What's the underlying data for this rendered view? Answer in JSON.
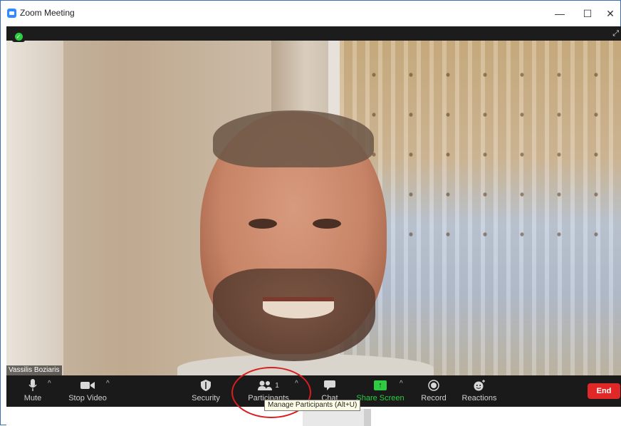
{
  "window": {
    "title": "Zoom Meeting",
    "controls": {
      "minimize": "—",
      "maximize": "☐",
      "close": "✕"
    }
  },
  "video": {
    "participant_name": "Vassilis Boziaris",
    "security_badge": "✓",
    "expand_icon": "⤢"
  },
  "toolbar": {
    "mute_label": "Mute",
    "stop_video_label": "Stop Video",
    "security_label": "Security",
    "participants_label": "Participants",
    "participants_count": "1",
    "chat_label": "Chat",
    "share_screen_label": "Share Screen",
    "record_label": "Record",
    "reactions_label": "Reactions",
    "end_label": "End",
    "caret": "^"
  },
  "tooltip": {
    "text": "Manage Participants (Alt+U)"
  },
  "colors": {
    "accent": "#2d8cff",
    "toolbar_bg": "#1a1a1a",
    "share_green": "#2ecc40",
    "end_red": "#e02828",
    "highlight_red": "#d81e1e"
  },
  "icons": {
    "app": "zoom-icon",
    "mute": "microphone-icon",
    "video": "video-camera-icon",
    "security": "shield-icon",
    "participants": "people-icon",
    "chat": "chat-bubble-icon",
    "share": "share-screen-icon",
    "record": "record-icon",
    "reactions": "smiley-icon"
  }
}
